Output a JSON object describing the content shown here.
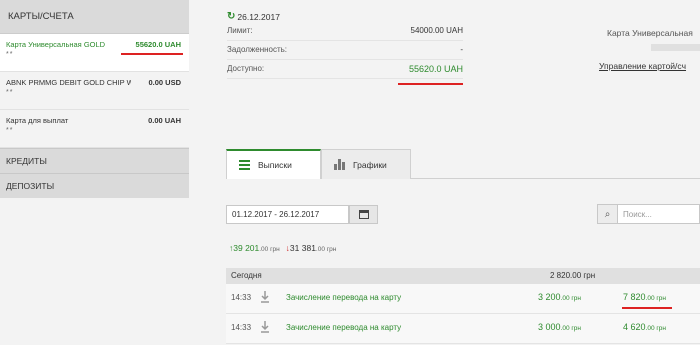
{
  "sidebar": {
    "header": "КАРТЫ/СЧЕТА",
    "accounts": [
      {
        "name": "Карта Универсальная GOLD",
        "amount": "55620.0 UAH",
        "mask": "**"
      },
      {
        "name": "ABNK PRMMG DEBIT GOLD CHIP W...",
        "amount": "0.00 USD",
        "mask": "**"
      },
      {
        "name": "Карта для выплат",
        "amount": "0.00 UAH",
        "mask": "**"
      }
    ],
    "sections": [
      "КРЕДИТЫ",
      "ДЕПОЗИТЫ"
    ]
  },
  "details": {
    "date": "26.12.2017",
    "rows": [
      {
        "label": "Лимит:",
        "value": "54000.00 UAH"
      },
      {
        "label": "Задолженность:",
        "value": "-"
      },
      {
        "label": "Доступно:",
        "value": "55620.0 UAH"
      }
    ],
    "card_title": "Карта Универсальная",
    "manage_link": "Управление картой/сч"
  },
  "tabs": [
    {
      "label": "Выписки",
      "icon": "list-icon",
      "active": true
    },
    {
      "label": "Графики",
      "icon": "bar-chart-icon",
      "active": false
    }
  ],
  "filter": {
    "date_range": "01.12.2017 - 26.12.2017",
    "search_placeholder": "Поиск..."
  },
  "totals": {
    "income_main": "39 201",
    "income_dec": ".00 грн",
    "outgo_main": "31 381",
    "outgo_dec": ".00 грн"
  },
  "transactions": {
    "group_label": "Сегодня",
    "group_sum": "2 820.00 грн",
    "rows": [
      {
        "time": "14:33",
        "description": "Зачисление перевода на карту",
        "amount_main": "3 200",
        "amount_dec": ".00 грн",
        "balance_main": "7 820",
        "balance_dec": ".00 грн"
      },
      {
        "time": "14:33",
        "description": "Зачисление перевода на карту",
        "amount_main": "3 000",
        "amount_dec": ".00 грн",
        "balance_main": "4 620",
        "balance_dec": ".00 грн"
      }
    ]
  },
  "colors": {
    "accent_green": "#2e8b2e",
    "highlight_red": "#dd2222",
    "sidebar_header_bg": "#dadada"
  }
}
